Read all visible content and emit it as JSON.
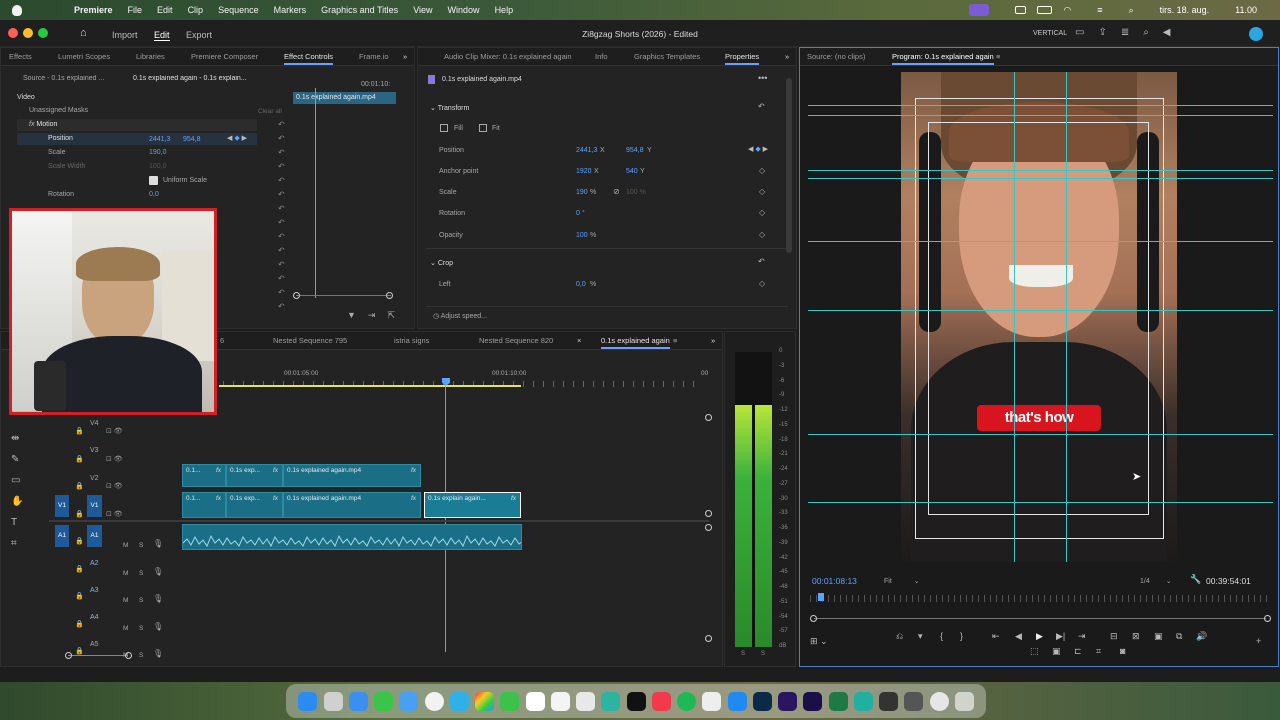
{
  "menubar": {
    "app": "Premiere",
    "items": [
      "File",
      "Edit",
      "Clip",
      "Sequence",
      "Markers",
      "Graphics and Titles",
      "View",
      "Window",
      "Help"
    ],
    "date": "tirs. 18. aug.",
    "time": "11.00"
  },
  "window": {
    "title": "Zi8gzag Shorts (2026) - Edited",
    "workspaces": [
      "Import",
      "Edit",
      "Export"
    ],
    "layout_label": "VERTICAL"
  },
  "left_panel": {
    "tabs": [
      "Effects",
      "Lumetri Scopes",
      "Libraries",
      "Premiere Composer",
      "Effect Controls",
      "Frame.io"
    ],
    "source_tab": "Source - 0.1s explained ...",
    "clip_tab": "0.1s explained again - 0.1s explain...",
    "timecode": "00:01:10:",
    "clip_bar": "0.1s explained again.mp4",
    "section_video": "Video",
    "masks": "Unassigned Masks",
    "clear_all": "Clear all",
    "motion": "Motion",
    "position_label": "Position",
    "position_x": "2441,3",
    "position_y": "954,8",
    "scale_label": "Scale",
    "scale_val": "190,0",
    "scale_width_label": "Scale Width",
    "scale_width_val": "100,0",
    "uniform_scale": "Uniform Scale",
    "rotation_label": "Rotation",
    "rotation_val": "0,0"
  },
  "middle_panel": {
    "tabs": [
      "Audio Clip Mixer: 0.1s explained again",
      "Info",
      "Graphics Templates",
      "Properties"
    ],
    "clip_name": "0.1s explained again.mp4",
    "transform": "Transform",
    "fill": "Fill",
    "fit": "Fit",
    "position_label": "Position",
    "position_x": "2441,3",
    "position_y": "954,8",
    "x": "X",
    "y": "Y",
    "anchor_label": "Anchor point",
    "anchor_x": "1920",
    "anchor_y": "540",
    "scale_label": "Scale",
    "scale_val": "190",
    "scale_unit": "%",
    "scale_width": "100 %",
    "rotation_label": "Rotation",
    "rotation_val": "0 °",
    "opacity_label": "Opacity",
    "opacity_val": "100",
    "crop": "Crop",
    "left_label": "Left",
    "left_val": "0,0",
    "adjust_speed": "Adjust speed..."
  },
  "timeline": {
    "tabs": [
      "6",
      "Nested Sequence 795",
      "istria signs",
      "Nested Sequence 820",
      "0.1s explained again"
    ],
    "ruler": [
      "00:01:05:00",
      "00:01:10:00",
      "00"
    ],
    "video_tracks": [
      "V4",
      "V3",
      "V2",
      "V1"
    ],
    "audio_tracks": [
      "A1",
      "A2",
      "A3",
      "A4",
      "A5"
    ],
    "src_v1": "V1",
    "src_a1": "A1",
    "mute": "M",
    "solo": "S",
    "clip_short": "0.1...",
    "clip_exp": "0.1s exp...",
    "clip_full": "0.1s explained again.mp4",
    "clip_sel": "0.1s explain again...",
    "fx": "fx"
  },
  "meter": {
    "scale": [
      "0",
      "-3",
      "-6",
      "-9",
      "-12",
      "-15",
      "-18",
      "-21",
      "-24",
      "-27",
      "-30",
      "-33",
      "-36",
      "-39",
      "-42",
      "-45",
      "-48",
      "-51",
      "-54",
      "-57",
      "dB"
    ],
    "bottom": [
      "S",
      "S"
    ]
  },
  "program": {
    "source_tab": "Source: (no clips)",
    "program_tab": "Program: 0.1s explained again",
    "caption": "that's how",
    "timecode": "00:01:08:13",
    "fit": "Fit",
    "resolution": "1/4",
    "duration": "00:39:54:01"
  },
  "colors": {
    "accent": "#5ca2ff",
    "clip": "#1a6f86",
    "guides": "#36c7c7",
    "caption": "#d8141e",
    "webcam_border": "#d31f26"
  }
}
